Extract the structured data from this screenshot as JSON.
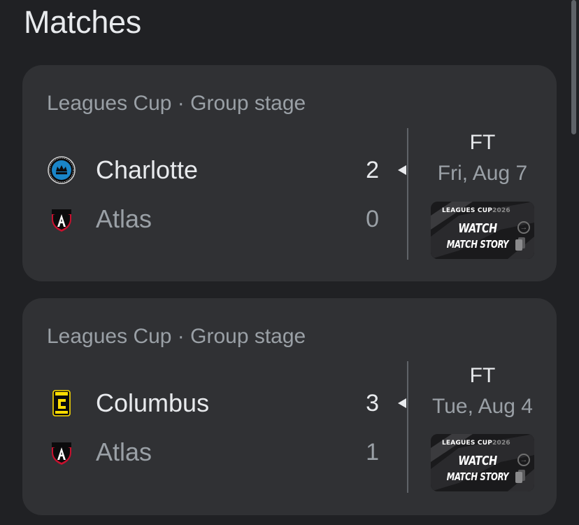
{
  "page": {
    "title": "Matches"
  },
  "matches": [
    {
      "competition": "Leagues Cup · Group stage",
      "status": "FT",
      "date": "Fri, Aug 7",
      "teams": [
        {
          "name": "Charlotte",
          "score": "2",
          "winner": true,
          "logo_icon": "charlotte-fc-crest-icon"
        },
        {
          "name": "Atlas",
          "score": "0",
          "winner": false,
          "logo_icon": "atlas-fc-crest-icon"
        }
      ],
      "highlight": {
        "brand_prefix": "LEAGUES CUP",
        "brand_suffix": "2026",
        "line1": "WATCH",
        "line2": "MATCH STORY"
      }
    },
    {
      "competition": "Leagues Cup · Group stage",
      "status": "FT",
      "date": "Tue, Aug 4",
      "teams": [
        {
          "name": "Columbus",
          "score": "3",
          "winner": true,
          "logo_icon": "columbus-crew-crest-icon"
        },
        {
          "name": "Atlas",
          "score": "1",
          "winner": false,
          "logo_icon": "atlas-fc-crest-icon"
        }
      ],
      "highlight": {
        "brand_prefix": "LEAGUES CUP",
        "brand_suffix": "2026",
        "line1": "WATCH",
        "line2": "MATCH STORY"
      }
    }
  ],
  "colors": {
    "background": "#202124",
    "card": "#303134",
    "primary_text": "#e8eaed",
    "secondary_text": "#9aa0a6",
    "charlotte_blue": "#1a85c8",
    "atlas_red": "#c8102e",
    "columbus_gold": "#fedd00"
  }
}
